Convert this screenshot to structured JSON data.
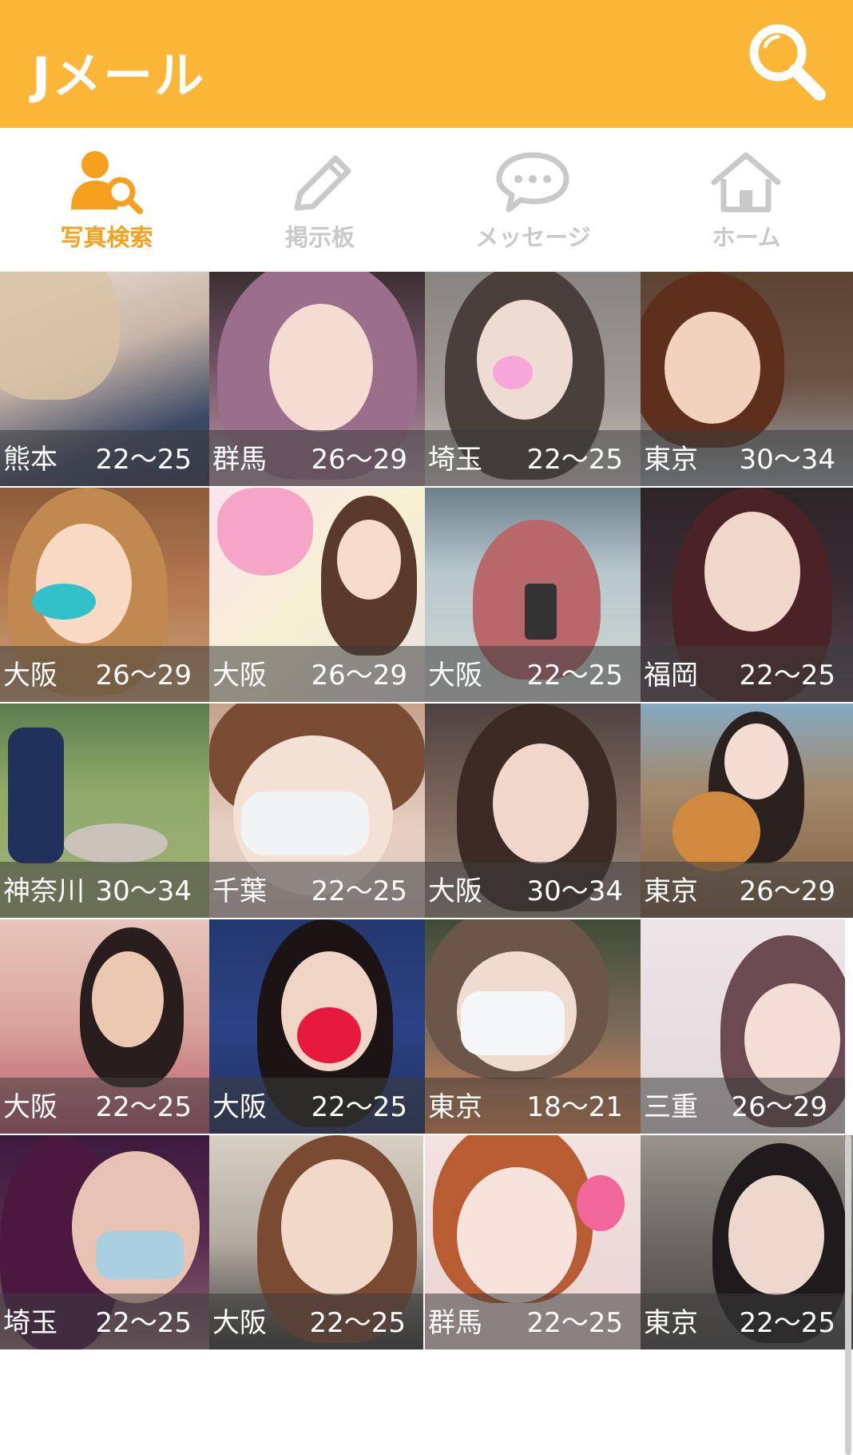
{
  "header": {
    "title": "Jメール",
    "search_icon": "search-icon",
    "background_color": "#fbb637"
  },
  "tabs": [
    {
      "label": "写真検索",
      "icon": "user-search-icon",
      "active": true
    },
    {
      "label": "掲示板",
      "icon": "pencil-icon",
      "active": false
    },
    {
      "label": "メッセージ",
      "icon": "chat-bubble-icon",
      "active": false
    },
    {
      "label": "ホーム",
      "icon": "home-icon",
      "active": false
    }
  ],
  "colors": {
    "accent": "#f5a11f",
    "inactive": "#c9c9c9"
  },
  "profiles": [
    {
      "pref": "熊本",
      "age": "22〜25"
    },
    {
      "pref": "群馬",
      "age": "26〜29"
    },
    {
      "pref": "埼玉",
      "age": "22〜25"
    },
    {
      "pref": "東京",
      "age": "30〜34"
    },
    {
      "pref": "大阪",
      "age": "26〜29"
    },
    {
      "pref": "大阪",
      "age": "26〜29"
    },
    {
      "pref": "大阪",
      "age": "22〜25"
    },
    {
      "pref": "福岡",
      "age": "22〜25"
    },
    {
      "pref": "神奈川",
      "age": "30〜34"
    },
    {
      "pref": "千葉",
      "age": "22〜25"
    },
    {
      "pref": "大阪",
      "age": "30〜34"
    },
    {
      "pref": "東京",
      "age": "26〜29"
    },
    {
      "pref": "大阪",
      "age": "22〜25"
    },
    {
      "pref": "大阪",
      "age": "22〜25"
    },
    {
      "pref": "東京",
      "age": "18〜21"
    },
    {
      "pref": "三重",
      "age": "26〜29"
    },
    {
      "pref": "埼玉",
      "age": "22〜25"
    },
    {
      "pref": "大阪",
      "age": "22〜25"
    },
    {
      "pref": "群馬",
      "age": "22〜25"
    },
    {
      "pref": "東京",
      "age": "22〜25"
    }
  ]
}
